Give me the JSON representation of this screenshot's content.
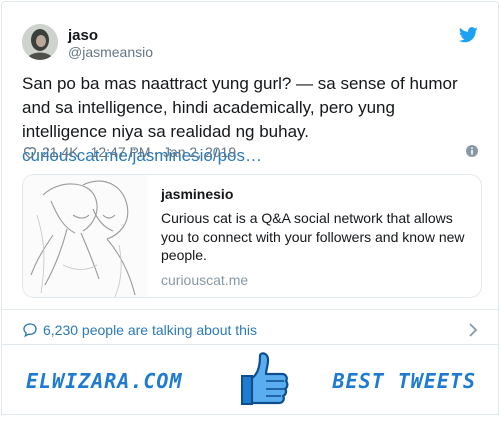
{
  "tweet": {
    "author_name": "jaso",
    "author_handle": "@jasmeansio",
    "text": "San po ba mas naattract yung gurl? — sa sense of humor and sa intelligence, hindi academically, pero yung intelligence niya sa realidad ng buhay. ",
    "link_text": "curiouscat.me/jasminesio/pos…",
    "likes": "21.4K",
    "timestamp": "12:47 PM - Jan 2, 2019"
  },
  "link_card": {
    "title": "jasminesio",
    "description": "Curious cat is a Q&A social network that allows you to connect with your followers and know new people.",
    "domain": "curiouscat.me"
  },
  "conversation": {
    "label": "6,230 people are talking about this"
  },
  "banner": {
    "left_text": "ELWIZARA.COM",
    "right_text": "BEST TWEETS"
  },
  "icons": {
    "twitter": "twitter-bird-icon",
    "heart": "heart-icon",
    "info": "info-icon",
    "bubble": "speech-bubble-icon",
    "chevron": "chevron-right-icon",
    "thumb": "thumbs-up-icon"
  },
  "colors": {
    "twitter_blue": "#1da1f2",
    "link_blue": "#2b7bb9",
    "banner_blue": "#1e7bd0",
    "muted": "#657786"
  }
}
